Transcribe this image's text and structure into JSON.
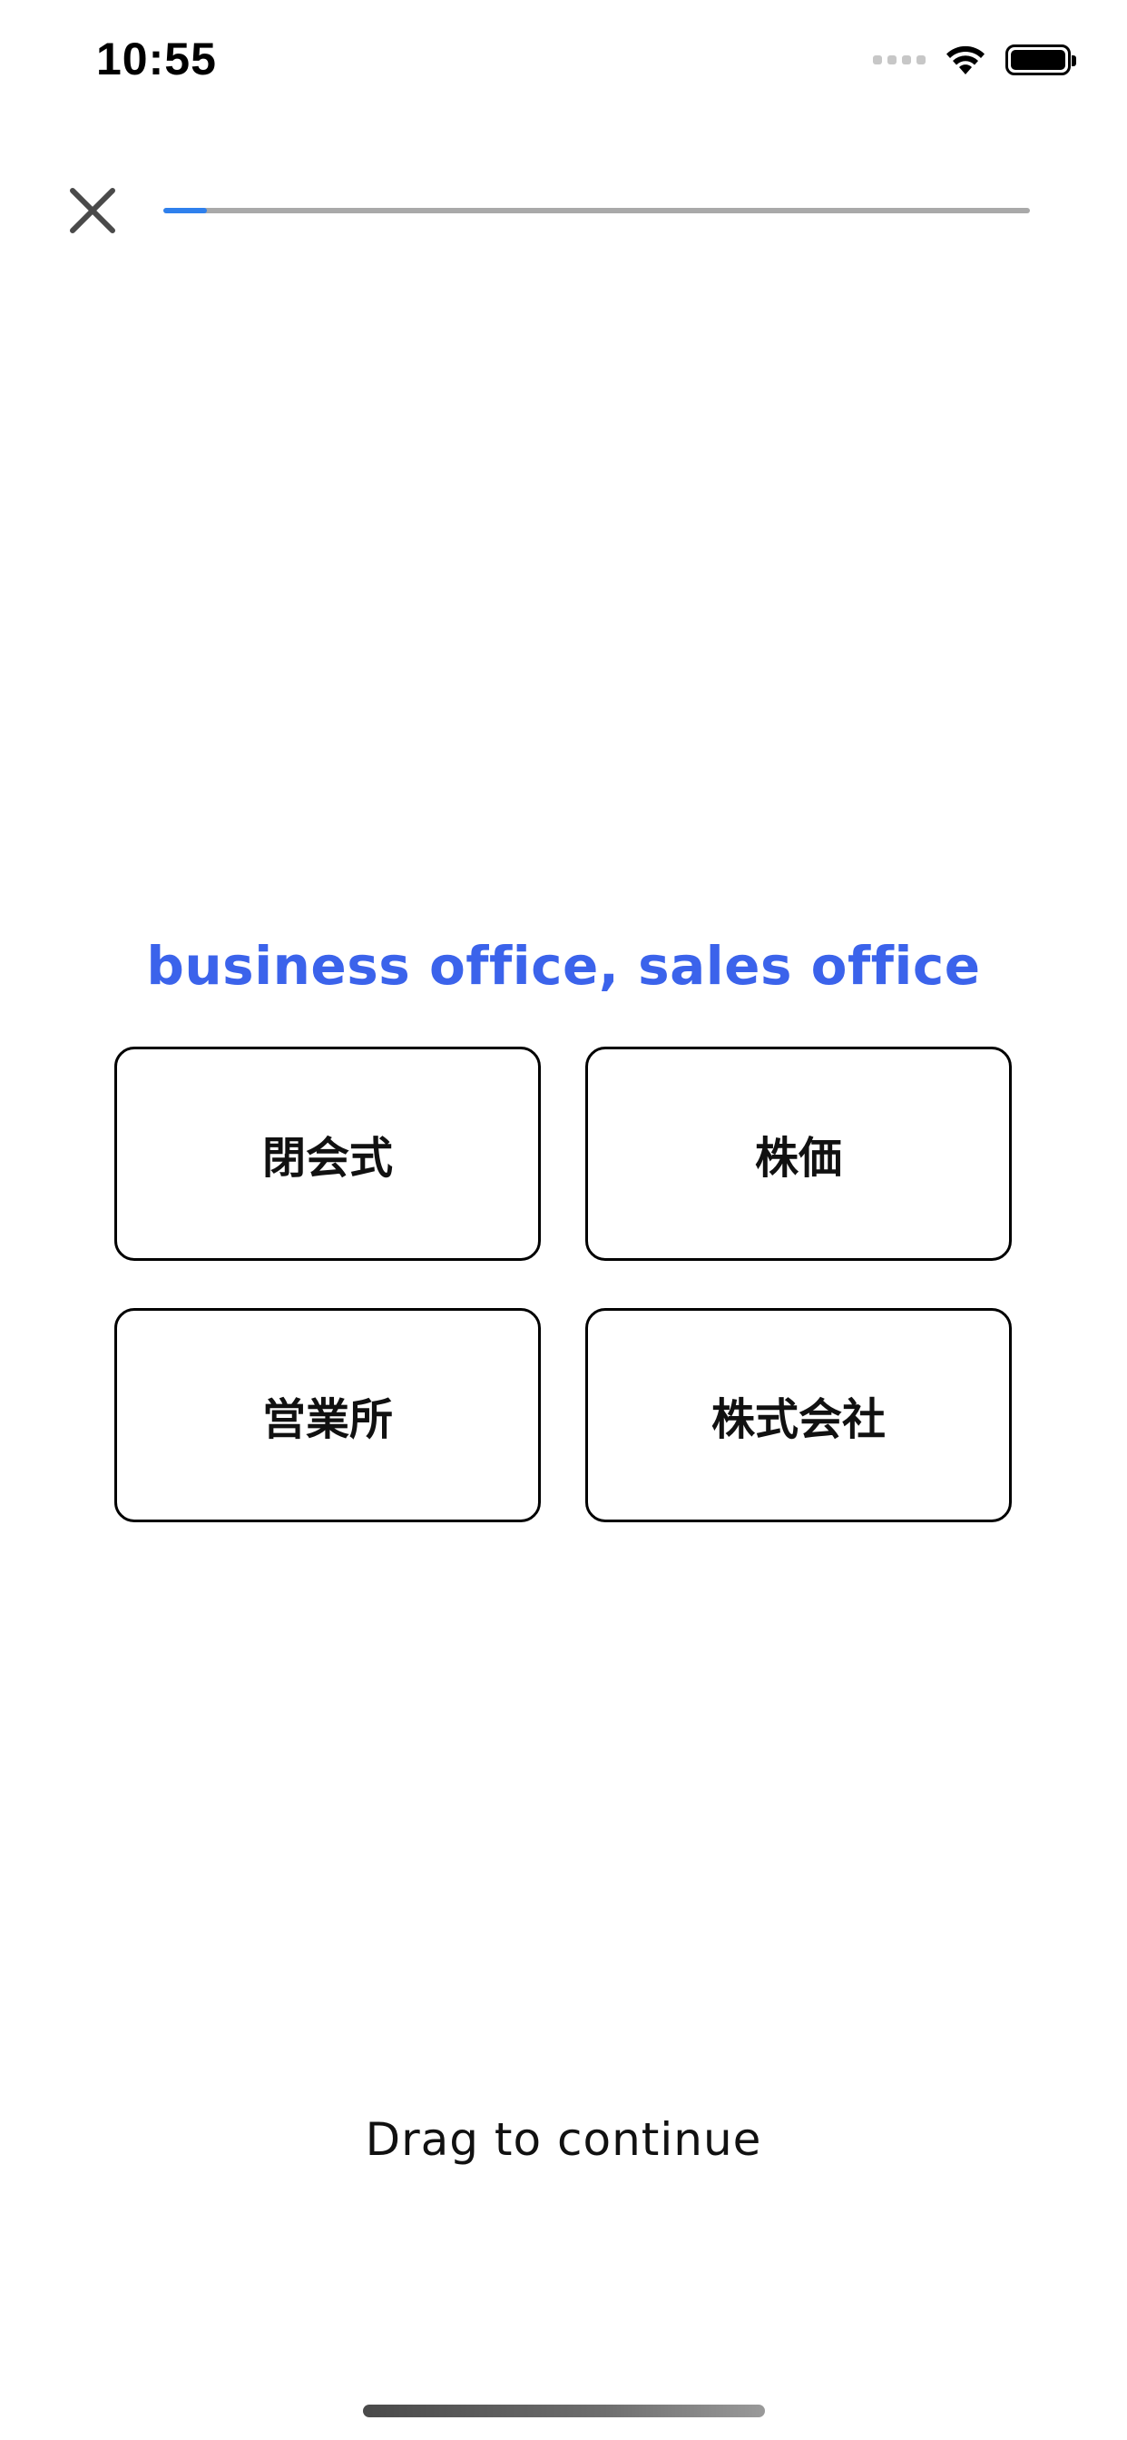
{
  "status_bar": {
    "time": "10:55",
    "icons": [
      "cellular-signal-icon",
      "wifi-icon",
      "battery-icon"
    ]
  },
  "nav": {
    "close_icon": "close-icon",
    "progress_fraction": 0.05,
    "progress_color": "#2f80ed",
    "track_color": "#a9a9a9"
  },
  "quiz": {
    "prompt": "business office, sales office",
    "prompt_color": "#3b63eb",
    "options": [
      {
        "label": "閉会式"
      },
      {
        "label": "株価"
      },
      {
        "label": "営業所"
      },
      {
        "label": "株式会社"
      }
    ]
  },
  "footer": {
    "hint": "Drag to continue"
  }
}
